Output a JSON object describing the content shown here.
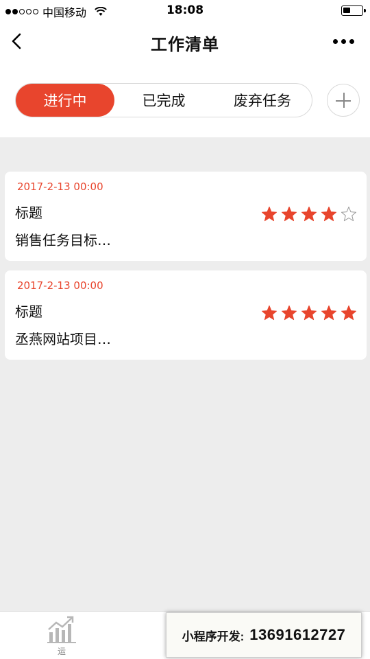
{
  "status_bar": {
    "carrier": "中国移动",
    "time": "18:08",
    "signal_filled": 2,
    "signal_total": 5,
    "battery_level": 0.4
  },
  "nav": {
    "title": "工作清单",
    "back_icon": "chevron-left-icon",
    "more_icon": "more-dots-icon"
  },
  "tabs": {
    "items": [
      {
        "label": "进行中",
        "active": true
      },
      {
        "label": "已完成",
        "active": false
      },
      {
        "label": "废弃任务",
        "active": false
      }
    ],
    "add_icon": "plus-icon"
  },
  "tasks": [
    {
      "date": "2017-2-13 00:00",
      "title": "标题",
      "desc": "销售任务目标…",
      "rating": 4,
      "max_rating": 5
    },
    {
      "date": "2017-2-13 00:00",
      "title": "标题",
      "desc": "丞燕网站项目…",
      "rating": 5,
      "max_rating": 5
    }
  ],
  "tabbar": {
    "items": [
      {
        "label": "运",
        "icon": "chart-growth-icon"
      }
    ]
  },
  "promo": {
    "label": "小程序开发:",
    "phone": "13691612727"
  },
  "colors": {
    "accent": "#e8452d",
    "background": "#ededed",
    "card": "#ffffff"
  }
}
